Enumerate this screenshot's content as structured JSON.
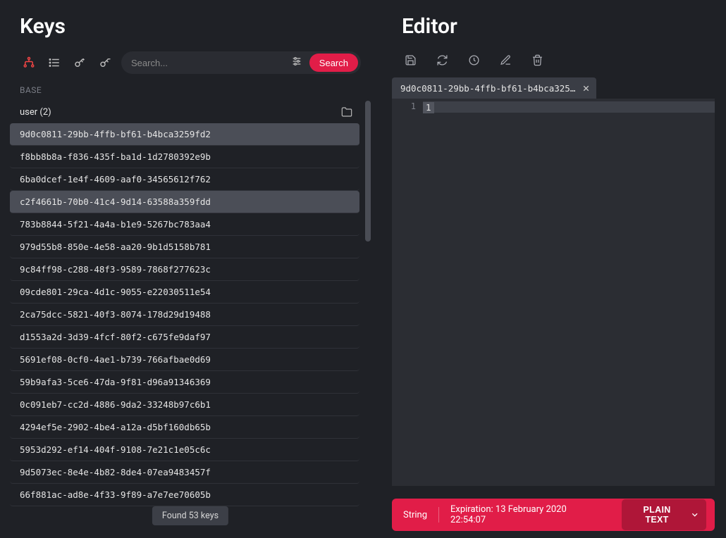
{
  "left": {
    "title": "Keys",
    "section_label": "BASE",
    "search": {
      "placeholder": "Search...",
      "button": "Search"
    },
    "folder": {
      "label": "user (2)"
    },
    "keys": [
      "9d0c0811-29bb-4ffb-bf61-b4bca3259fd2",
      "f8bb8b8a-f836-435f-ba1d-1d2780392e9b",
      "6ba0dcef-1e4f-4609-aaf0-34565612f762",
      "c2f4661b-70b0-41c4-9d14-63588a359fdd",
      "783b8844-5f21-4a4a-b1e9-5267bc783aa4",
      "979d55b8-850e-4e58-aa20-9b1d5158b781",
      "9c84ff98-c288-48f3-9589-7868f277623c",
      "09cde801-29ca-4d1c-9055-e22030511e54",
      "2ca75dcc-5821-40f3-8074-178d29d19488",
      "d1553a2d-3d39-4fcf-80f2-c675fe9daf97",
      "5691ef08-0cf0-4ae1-b739-766afbae0d69",
      "59b9afa3-5ce6-47da-9f81-d96a91346369",
      "0c091eb7-cc2d-4886-9da2-33248b97c6b1",
      "4294ef5e-2902-4be4-a12a-d5bf160db65b",
      "5953d292-ef14-404f-9108-7e21c1e05c6c",
      "9d5073ec-8e4e-4b82-8de4-07ea9483457f",
      "66f881ac-ad8e-4f33-9f89-a7e7ee70605b"
    ],
    "selected_indices": [
      0,
      3
    ],
    "found_toast": "Found 53 keys"
  },
  "right": {
    "title": "Editor",
    "tab": {
      "label": "9d0c0811-29bb-4ffb-bf61-b4bca3259f..."
    },
    "gutter": "1",
    "content": "1",
    "status": {
      "type": "String",
      "expiration": "Expiration: 13 February 2020 22:54:07",
      "format": "PLAIN TEXT"
    }
  }
}
